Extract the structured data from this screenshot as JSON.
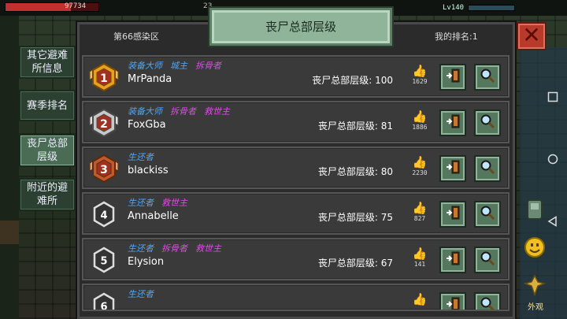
{
  "hud": {
    "hp_value": "97734",
    "level_label": "Lv140",
    "top_number": "23"
  },
  "panel": {
    "title": "丧尸总部层级",
    "zone": "第66感染区",
    "my_rank": "我的排名:1"
  },
  "tabs": [
    {
      "label": "其它避难所信息",
      "active": false
    },
    {
      "label": "赛季排名",
      "active": false
    },
    {
      "label": "丧尸总部层级",
      "active": true
    },
    {
      "label": "附近的避难所",
      "active": false
    }
  ],
  "level_prefix": "丧尸总部层级:",
  "rows": [
    {
      "rank": "1",
      "name": "MrPanda",
      "level": "丧尸总部层级: 100",
      "likes": "1629",
      "titles": [
        {
          "text": "装备大师",
          "color": "blue"
        },
        {
          "text": "城主",
          "color": "blue"
        },
        {
          "text": "拆骨者",
          "color": "magenta"
        }
      ]
    },
    {
      "rank": "2",
      "name": "FoxGba",
      "level": "丧尸总部层级: 81",
      "likes": "1886",
      "titles": [
        {
          "text": "装备大师",
          "color": "blue"
        },
        {
          "text": "拆骨者",
          "color": "magenta"
        },
        {
          "text": "救世主",
          "color": "magenta"
        }
      ]
    },
    {
      "rank": "3",
      "name": "blackiss",
      "level": "丧尸总部层级: 80",
      "likes": "2230",
      "titles": [
        {
          "text": "生还者",
          "color": "blue"
        }
      ]
    },
    {
      "rank": "4",
      "name": "Annabelle",
      "level": "丧尸总部层级: 75",
      "likes": "827",
      "titles": [
        {
          "text": "生还者",
          "color": "blue"
        },
        {
          "text": "救世主",
          "color": "magenta"
        }
      ]
    },
    {
      "rank": "5",
      "name": "Elysion",
      "level": "丧尸总部层级: 67",
      "likes": "141",
      "titles": [
        {
          "text": "生还者",
          "color": "blue"
        },
        {
          "text": "拆骨者",
          "color": "magenta"
        },
        {
          "text": "救世主",
          "color": "magenta"
        }
      ]
    },
    {
      "rank": "6",
      "name": "",
      "level": "",
      "likes": "",
      "titles": [
        {
          "text": "生还者",
          "color": "blue"
        }
      ]
    }
  ],
  "side": {
    "view_label": "外观"
  },
  "colors": {
    "gold": "#e8a020",
    "silver": "#b8b8b8",
    "bronze": "#c05a2a",
    "title_blue": "#4aa8ff",
    "title_magenta": "#e04ae8",
    "panel_green": "#8fb49a",
    "close_red": "#b83a2a"
  },
  "icons": {
    "like": "thumbs-up-icon",
    "visit": "enter-door-icon",
    "inspect": "magnifier-icon",
    "close": "close-icon"
  }
}
